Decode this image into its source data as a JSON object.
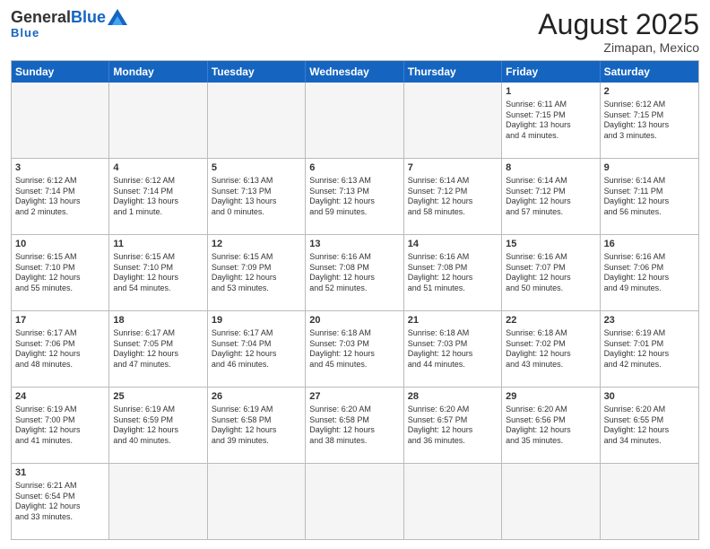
{
  "header": {
    "logo_general": "General",
    "logo_blue": "Blue",
    "month_title": "August 2025",
    "location": "Zimapan, Mexico"
  },
  "calendar": {
    "days_of_week": [
      "Sunday",
      "Monday",
      "Tuesday",
      "Wednesday",
      "Thursday",
      "Friday",
      "Saturday"
    ],
    "rows": [
      [
        {
          "day": "",
          "info": "",
          "empty": true
        },
        {
          "day": "",
          "info": "",
          "empty": true
        },
        {
          "day": "",
          "info": "",
          "empty": true
        },
        {
          "day": "",
          "info": "",
          "empty": true
        },
        {
          "day": "",
          "info": "",
          "empty": true
        },
        {
          "day": "1",
          "info": "Sunrise: 6:11 AM\nSunset: 7:15 PM\nDaylight: 13 hours\nand 4 minutes.",
          "empty": false
        },
        {
          "day": "2",
          "info": "Sunrise: 6:12 AM\nSunset: 7:15 PM\nDaylight: 13 hours\nand 3 minutes.",
          "empty": false
        }
      ],
      [
        {
          "day": "3",
          "info": "Sunrise: 6:12 AM\nSunset: 7:14 PM\nDaylight: 13 hours\nand 2 minutes.",
          "empty": false
        },
        {
          "day": "4",
          "info": "Sunrise: 6:12 AM\nSunset: 7:14 PM\nDaylight: 13 hours\nand 1 minute.",
          "empty": false
        },
        {
          "day": "5",
          "info": "Sunrise: 6:13 AM\nSunset: 7:13 PM\nDaylight: 13 hours\nand 0 minutes.",
          "empty": false
        },
        {
          "day": "6",
          "info": "Sunrise: 6:13 AM\nSunset: 7:13 PM\nDaylight: 12 hours\nand 59 minutes.",
          "empty": false
        },
        {
          "day": "7",
          "info": "Sunrise: 6:14 AM\nSunset: 7:12 PM\nDaylight: 12 hours\nand 58 minutes.",
          "empty": false
        },
        {
          "day": "8",
          "info": "Sunrise: 6:14 AM\nSunset: 7:12 PM\nDaylight: 12 hours\nand 57 minutes.",
          "empty": false
        },
        {
          "day": "9",
          "info": "Sunrise: 6:14 AM\nSunset: 7:11 PM\nDaylight: 12 hours\nand 56 minutes.",
          "empty": false
        }
      ],
      [
        {
          "day": "10",
          "info": "Sunrise: 6:15 AM\nSunset: 7:10 PM\nDaylight: 12 hours\nand 55 minutes.",
          "empty": false
        },
        {
          "day": "11",
          "info": "Sunrise: 6:15 AM\nSunset: 7:10 PM\nDaylight: 12 hours\nand 54 minutes.",
          "empty": false
        },
        {
          "day": "12",
          "info": "Sunrise: 6:15 AM\nSunset: 7:09 PM\nDaylight: 12 hours\nand 53 minutes.",
          "empty": false
        },
        {
          "day": "13",
          "info": "Sunrise: 6:16 AM\nSunset: 7:08 PM\nDaylight: 12 hours\nand 52 minutes.",
          "empty": false
        },
        {
          "day": "14",
          "info": "Sunrise: 6:16 AM\nSunset: 7:08 PM\nDaylight: 12 hours\nand 51 minutes.",
          "empty": false
        },
        {
          "day": "15",
          "info": "Sunrise: 6:16 AM\nSunset: 7:07 PM\nDaylight: 12 hours\nand 50 minutes.",
          "empty": false
        },
        {
          "day": "16",
          "info": "Sunrise: 6:16 AM\nSunset: 7:06 PM\nDaylight: 12 hours\nand 49 minutes.",
          "empty": false
        }
      ],
      [
        {
          "day": "17",
          "info": "Sunrise: 6:17 AM\nSunset: 7:06 PM\nDaylight: 12 hours\nand 48 minutes.",
          "empty": false
        },
        {
          "day": "18",
          "info": "Sunrise: 6:17 AM\nSunset: 7:05 PM\nDaylight: 12 hours\nand 47 minutes.",
          "empty": false
        },
        {
          "day": "19",
          "info": "Sunrise: 6:17 AM\nSunset: 7:04 PM\nDaylight: 12 hours\nand 46 minutes.",
          "empty": false
        },
        {
          "day": "20",
          "info": "Sunrise: 6:18 AM\nSunset: 7:03 PM\nDaylight: 12 hours\nand 45 minutes.",
          "empty": false
        },
        {
          "day": "21",
          "info": "Sunrise: 6:18 AM\nSunset: 7:03 PM\nDaylight: 12 hours\nand 44 minutes.",
          "empty": false
        },
        {
          "day": "22",
          "info": "Sunrise: 6:18 AM\nSunset: 7:02 PM\nDaylight: 12 hours\nand 43 minutes.",
          "empty": false
        },
        {
          "day": "23",
          "info": "Sunrise: 6:19 AM\nSunset: 7:01 PM\nDaylight: 12 hours\nand 42 minutes.",
          "empty": false
        }
      ],
      [
        {
          "day": "24",
          "info": "Sunrise: 6:19 AM\nSunset: 7:00 PM\nDaylight: 12 hours\nand 41 minutes.",
          "empty": false
        },
        {
          "day": "25",
          "info": "Sunrise: 6:19 AM\nSunset: 6:59 PM\nDaylight: 12 hours\nand 40 minutes.",
          "empty": false
        },
        {
          "day": "26",
          "info": "Sunrise: 6:19 AM\nSunset: 6:58 PM\nDaylight: 12 hours\nand 39 minutes.",
          "empty": false
        },
        {
          "day": "27",
          "info": "Sunrise: 6:20 AM\nSunset: 6:58 PM\nDaylight: 12 hours\nand 38 minutes.",
          "empty": false
        },
        {
          "day": "28",
          "info": "Sunrise: 6:20 AM\nSunset: 6:57 PM\nDaylight: 12 hours\nand 36 minutes.",
          "empty": false
        },
        {
          "day": "29",
          "info": "Sunrise: 6:20 AM\nSunset: 6:56 PM\nDaylight: 12 hours\nand 35 minutes.",
          "empty": false
        },
        {
          "day": "30",
          "info": "Sunrise: 6:20 AM\nSunset: 6:55 PM\nDaylight: 12 hours\nand 34 minutes.",
          "empty": false
        }
      ],
      [
        {
          "day": "31",
          "info": "Sunrise: 6:21 AM\nSunset: 6:54 PM\nDaylight: 12 hours\nand 33 minutes.",
          "empty": false
        },
        {
          "day": "",
          "info": "",
          "empty": true
        },
        {
          "day": "",
          "info": "",
          "empty": true
        },
        {
          "day": "",
          "info": "",
          "empty": true
        },
        {
          "day": "",
          "info": "",
          "empty": true
        },
        {
          "day": "",
          "info": "",
          "empty": true
        },
        {
          "day": "",
          "info": "",
          "empty": true
        }
      ]
    ]
  }
}
